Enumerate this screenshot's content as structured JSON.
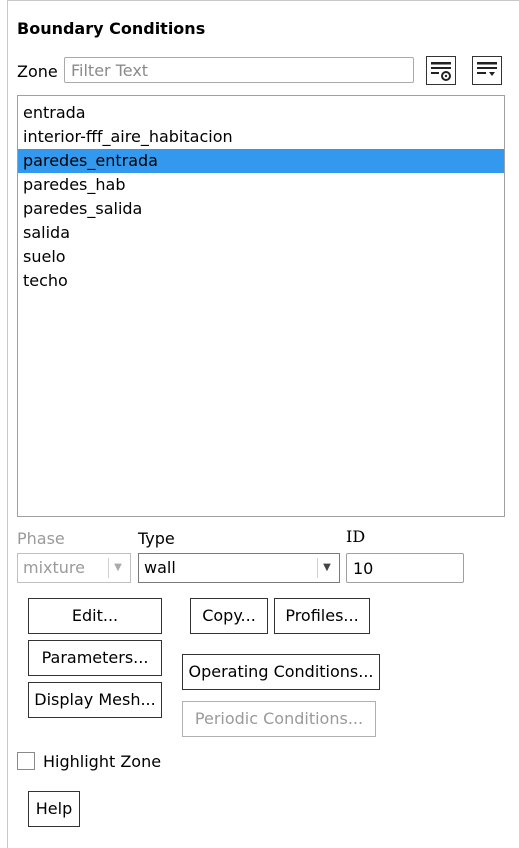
{
  "panel": {
    "title": "Boundary Conditions"
  },
  "zone": {
    "label": "Zone",
    "filter_placeholder": "Filter Text",
    "filter_value": "",
    "icons": [
      "filter-settings-icon",
      "filter-dropdown-icon"
    ]
  },
  "zones": [
    {
      "label": "entrada",
      "selected": false
    },
    {
      "label": "interior-fff_aire_habitacion",
      "selected": false
    },
    {
      "label": "paredes_entrada",
      "selected": true
    },
    {
      "label": "paredes_hab",
      "selected": false
    },
    {
      "label": "paredes_salida",
      "selected": false
    },
    {
      "label": "salida",
      "selected": false
    },
    {
      "label": "suelo",
      "selected": false
    },
    {
      "label": "techo",
      "selected": false
    }
  ],
  "phase": {
    "label": "Phase",
    "value": "mixture",
    "enabled": false
  },
  "type": {
    "label": "Type",
    "value": "wall"
  },
  "id": {
    "label": "ID",
    "value": "10"
  },
  "buttons": {
    "edit": "Edit...",
    "copy": "Copy...",
    "profiles": "Profiles...",
    "parameters": "Parameters...",
    "operating_conditions": "Operating Conditions...",
    "display_mesh": "Display Mesh...",
    "periodic_conditions": "Periodic Conditions...",
    "help": "Help"
  },
  "highlight_zone": {
    "label": "Highlight Zone",
    "checked": false
  },
  "colors": {
    "selection": "#3399ee",
    "disabled_text": "#9a9a9a"
  }
}
